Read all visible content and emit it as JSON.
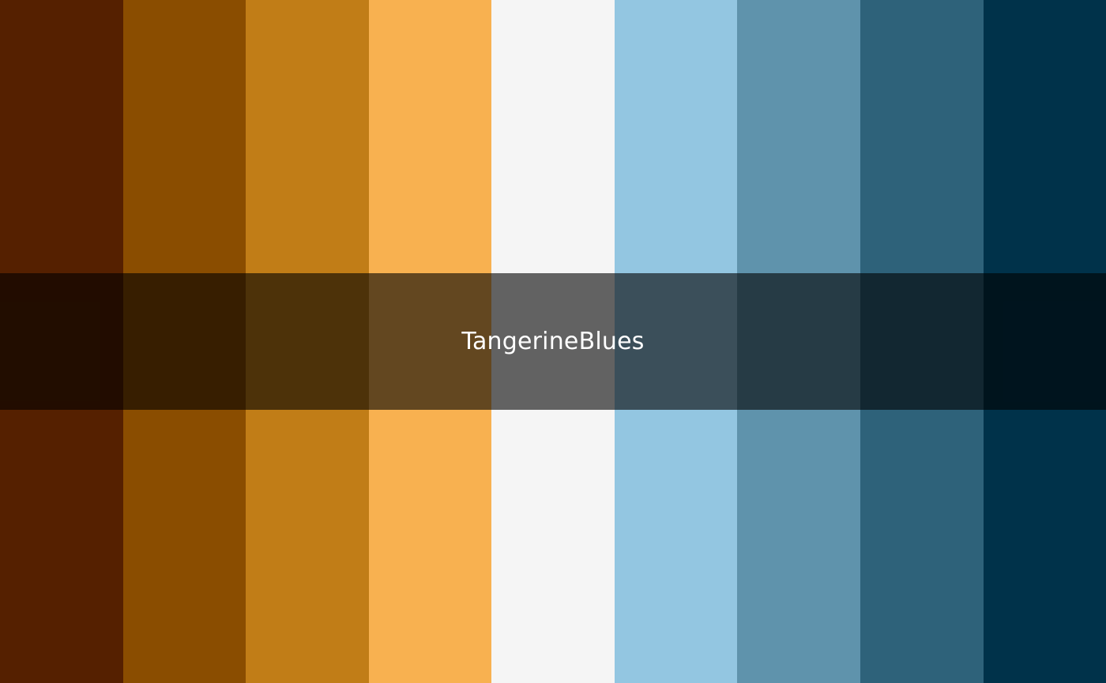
{
  "palette": {
    "name": "TangerineBlues",
    "colors": [
      "#552000",
      "#8A4D00",
      "#C17D17",
      "#F8B150",
      "#F5F5F5",
      "#93C6E1",
      "#5F93AC",
      "#2E627A",
      "#00324A"
    ]
  }
}
